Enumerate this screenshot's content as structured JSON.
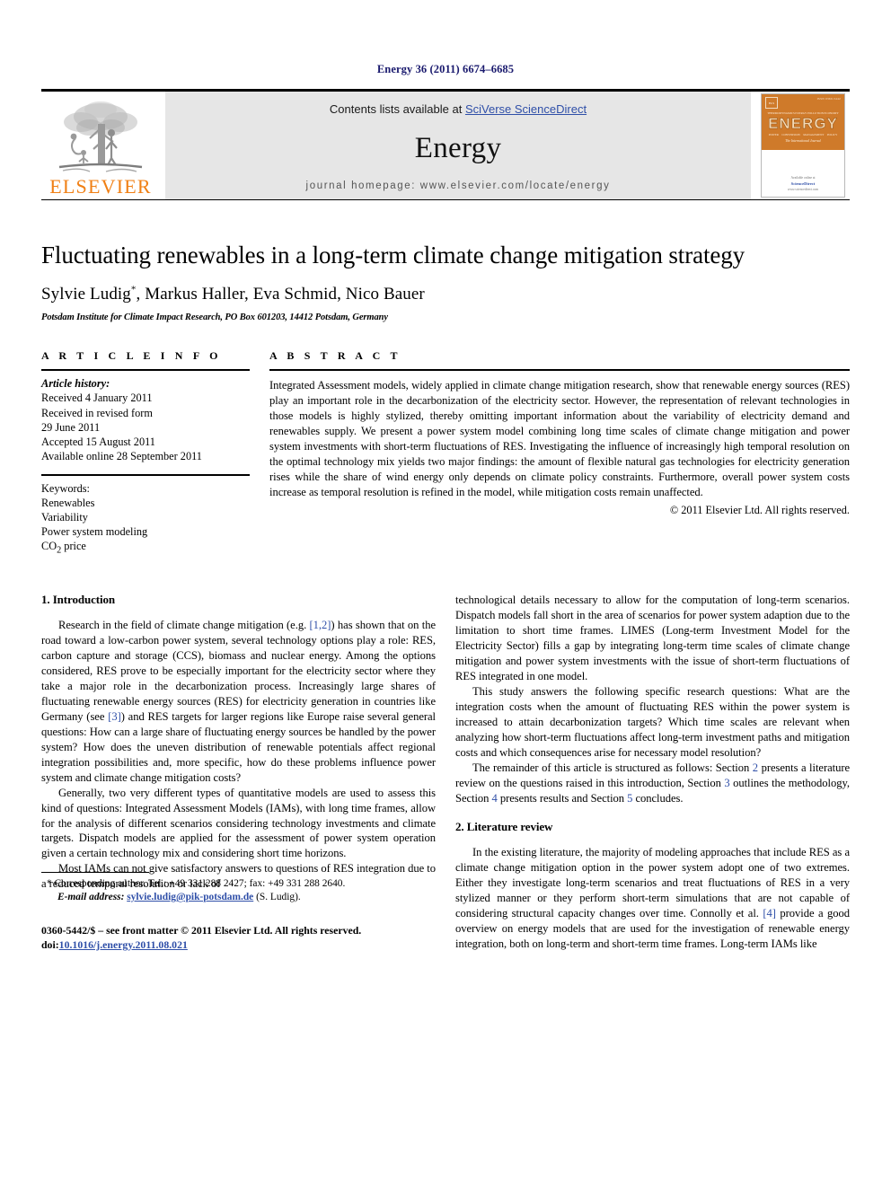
{
  "running_head": "Energy 36 (2011) 6674–6685",
  "masthead": {
    "publisher_wordmark": "ELSEVIER",
    "contents_prefix": "Contents lists available at ",
    "contents_link": "SciVerse ScienceDirect",
    "journal_title": "Energy",
    "homepage": "journal homepage: www.elsevier.com/locate/energy",
    "cover": {
      "issue_label": "ISSN 0360-5442",
      "title": "ENERGY",
      "subtitle": "The International Journal",
      "topics_top": [
        "THERMODYNAMICS",
        "EXERGY",
        "POLLUTION",
        "ECONOMY"
      ],
      "topics_bottom": [
        "POWER",
        "CONVERSION",
        "MANAGEMENT",
        "POLICY"
      ],
      "footer_top": "Available online at",
      "footer_link": "ScienceDirect",
      "footer_url": "www.sciencedirect.com"
    }
  },
  "article": {
    "title": "Fluctuating renewables in a long-term climate change mitigation strategy",
    "authors": "Sylvie Ludig, Markus Haller, Eva Schmid, Nico Bauer",
    "corresponding_marker": "*",
    "affiliation": "Potsdam Institute for Climate Impact Research, PO Box 601203, 14412 Potsdam, Germany"
  },
  "article_info": {
    "heading": "A R T I C L E  I N F O",
    "history_label": "Article history:",
    "history": [
      "Received 4 January 2011",
      "Received in revised form",
      "29 June 2011",
      "Accepted 15 August 2011",
      "Available online 28 September 2011"
    ],
    "keywords_label": "Keywords:",
    "keywords": [
      "Renewables",
      "Variability",
      "Power system modeling",
      "CO2 price"
    ]
  },
  "abstract": {
    "heading": "A B S T R A C T",
    "text": "Integrated Assessment models, widely applied in climate change mitigation research, show that renewable energy sources (RES) play an important role in the decarbonization of the electricity sector. However, the representation of relevant technologies in those models is highly stylized, thereby omitting important information about the variability of electricity demand and renewables supply. We present a power system model combining long time scales of climate change mitigation and power system investments with short-term fluctuations of RES. Investigating the influence of increasingly high temporal resolution on the optimal technology mix yields two major findings: the amount of flexible natural gas technologies for electricity generation rises while the share of wind energy only depends on climate policy constraints. Furthermore, overall power system costs increase as temporal resolution is refined in the model, while mitigation costs remain unaffected.",
    "copyright": "© 2011 Elsevier Ltd. All rights reserved."
  },
  "body": {
    "section1_title": "1. Introduction",
    "section2_title": "2. Literature review",
    "left_paragraphs": [
      "Research in the field of climate change mitigation (e.g. [1,2]) has shown that on the road toward a low-carbon power system, several technology options play a role: RES, carbon capture and storage (CCS), biomass and nuclear energy. Among the options considered, RES prove to be especially important for the electricity sector where they take a major role in the decarbonization process. Increasingly large shares of fluctuating renewable energy sources (RES) for electricity generation in countries like Germany (see [3]) and RES targets for larger regions like Europe raise several general questions: How can a large share of fluctuating energy sources be handled by the power system? How does the uneven distribution of renewable potentials affect regional integration possibilities and, more specific, how do these problems influence power system and climate change mitigation costs?",
      "Generally, two very different types of quantitative models are used to assess this kind of questions: Integrated Assessment Models (IAMs), with long time frames, allow for the analysis of different scenarios considering technology investments and climate targets. Dispatch models are applied for the assessment of power system operation given a certain technology mix and considering short time horizons.",
      "Most IAMs can not give satisfactory answers to questions of RES integration due to a reduced temporal resolution or lack of"
    ],
    "right_paragraphs": [
      "technological details necessary to allow for the computation of long-term scenarios. Dispatch models fall short in the area of scenarios for power system adaption due to the limitation to short time frames. LIMES (Long-term Investment Model for the Electricity Sector) fills a gap by integrating long-term time scales of climate change mitigation and power system investments with the issue of short-term fluctuations of RES integrated in one model.",
      "This study answers the following specific research questions: What are the integration costs when the amount of fluctuating RES within the power system is increased to attain decarbonization targets? Which time scales are relevant when analyzing how short-term fluctuations affect long-term investment paths and mitigation costs and which consequences arise for necessary model resolution?",
      "The remainder of this article is structured as follows: Section 2 presents a literature review on the questions raised in this introduction, Section 3 outlines the methodology, Section 4 presents results and Section 5 concludes."
    ],
    "right_paragraphs_sec2": [
      "In the existing literature, the majority of modeling approaches that include RES as a climate change mitigation option in the power system adopt one of two extremes. Either they investigate long-term scenarios and treat fluctuations of RES in a very stylized manner or they perform short-term simulations that are not capable of considering structural capacity changes over time. Connolly et al. [4] provide a good overview on energy models that are used for the investigation of renewable energy integration, both on long-term and short-term time frames. Long-term IAMs like"
    ]
  },
  "footnote": {
    "corresponding": "* Corresponding author. Tel.: +49 331 288 2427; fax: +49 331 288 2640.",
    "email_label": "E-mail address:",
    "email": "sylvie.ludig@pik-potsdam.de",
    "email_suffix": "(S. Ludig).",
    "issn_line": "0360-5442/$ – see front matter © 2011 Elsevier Ltd. All rights reserved.",
    "doi_label": "doi:",
    "doi": "10.1016/j.energy.2011.08.021"
  },
  "colors": {
    "link_blue": "#2f4fa8",
    "elsevier_orange": "#F07F13",
    "cover_orange": "#cf7a2a",
    "masthead_gray": "#e6e6e6"
  }
}
